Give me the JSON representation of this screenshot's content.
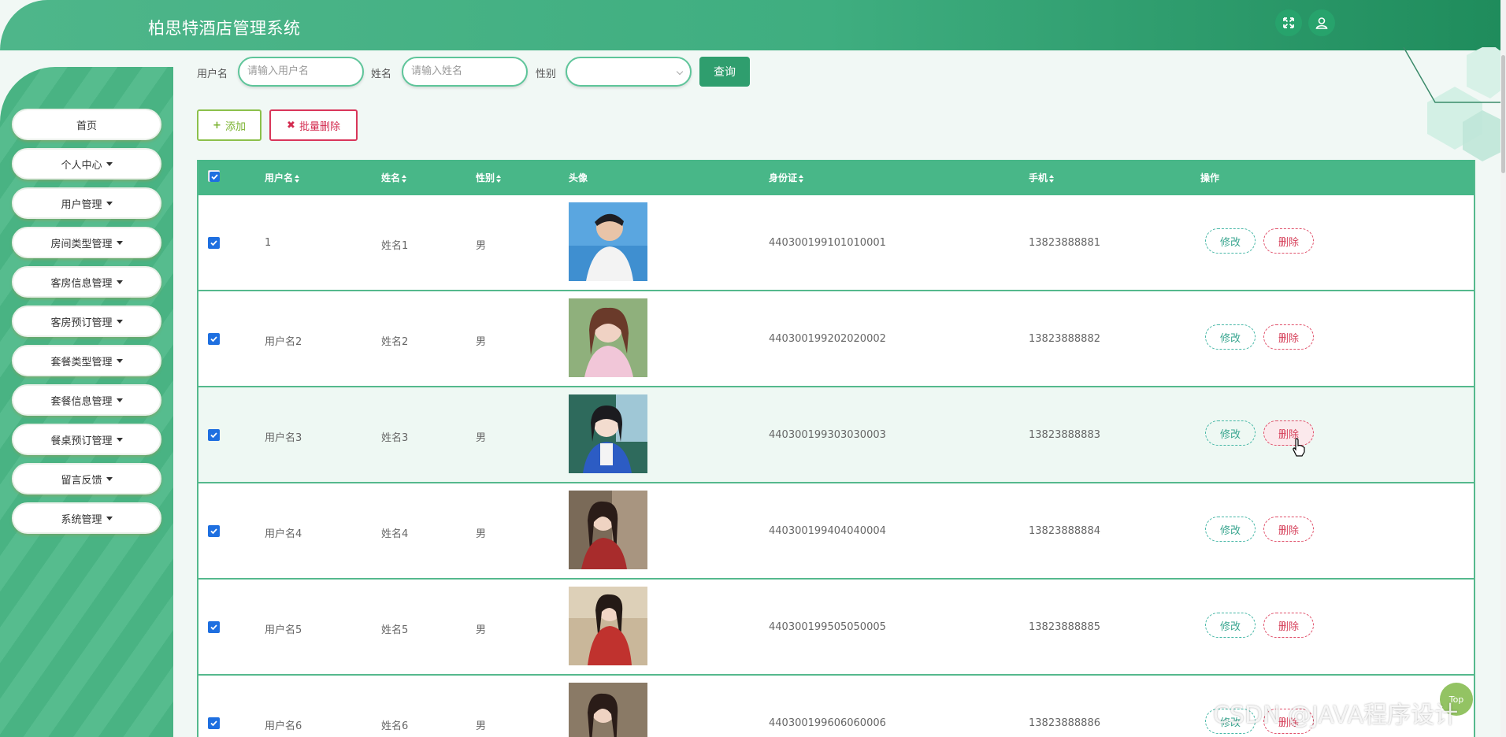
{
  "header": {
    "title": "柏思特酒店管理系统",
    "fullscreen_icon": "expand-icon",
    "user_icon": "user-icon"
  },
  "sidebar": {
    "items": [
      {
        "label": "首页",
        "dropdown": false
      },
      {
        "label": "个人中心",
        "dropdown": true
      },
      {
        "label": "用户管理",
        "dropdown": true
      },
      {
        "label": "房间类型管理",
        "dropdown": true
      },
      {
        "label": "客房信息管理",
        "dropdown": true
      },
      {
        "label": "客房预订管理",
        "dropdown": true
      },
      {
        "label": "套餐类型管理",
        "dropdown": true
      },
      {
        "label": "套餐信息管理",
        "dropdown": true
      },
      {
        "label": "餐桌预订管理",
        "dropdown": true
      },
      {
        "label": "留言反馈",
        "dropdown": true
      },
      {
        "label": "系统管理",
        "dropdown": true
      }
    ]
  },
  "search": {
    "username_label": "用户名",
    "username_placeholder": "请输入用户名",
    "name_label": "姓名",
    "name_placeholder": "请输入姓名",
    "gender_label": "性别",
    "gender_value": "",
    "query_label": "查询"
  },
  "actions": {
    "add_label": "添加",
    "bulk_delete_label": "批量删除"
  },
  "table": {
    "columns": [
      "用户名",
      "姓名",
      "性别",
      "头像",
      "身份证",
      "手机",
      "操作"
    ],
    "edit_label": "修改",
    "delete_label": "删除",
    "rows": [
      {
        "username": "1",
        "name": "姓名1",
        "gender": "男",
        "id_card": "440300199101010001",
        "phone": "13823888881",
        "checked": true
      },
      {
        "username": "用户名2",
        "name": "姓名2",
        "gender": "男",
        "id_card": "440300199202020002",
        "phone": "13823888882",
        "checked": true
      },
      {
        "username": "用户名3",
        "name": "姓名3",
        "gender": "男",
        "id_card": "440300199303030003",
        "phone": "13823888883",
        "checked": true
      },
      {
        "username": "用户名4",
        "name": "姓名4",
        "gender": "男",
        "id_card": "440300199404040004",
        "phone": "13823888884",
        "checked": true
      },
      {
        "username": "用户名5",
        "name": "姓名5",
        "gender": "男",
        "id_card": "440300199505050005",
        "phone": "13823888885",
        "checked": true
      },
      {
        "username": "用户名6",
        "name": "姓名6",
        "gender": "男",
        "id_card": "440300199606060006",
        "phone": "13823888886",
        "checked": true
      }
    ]
  },
  "back_to_top_label": "Top",
  "watermark": "CSDN @JAVA程序设计",
  "colors": {
    "primary": "#48b788",
    "dark_green": "#2f9e6e",
    "danger": "#d6405a",
    "add_green": "#7ab22f"
  }
}
